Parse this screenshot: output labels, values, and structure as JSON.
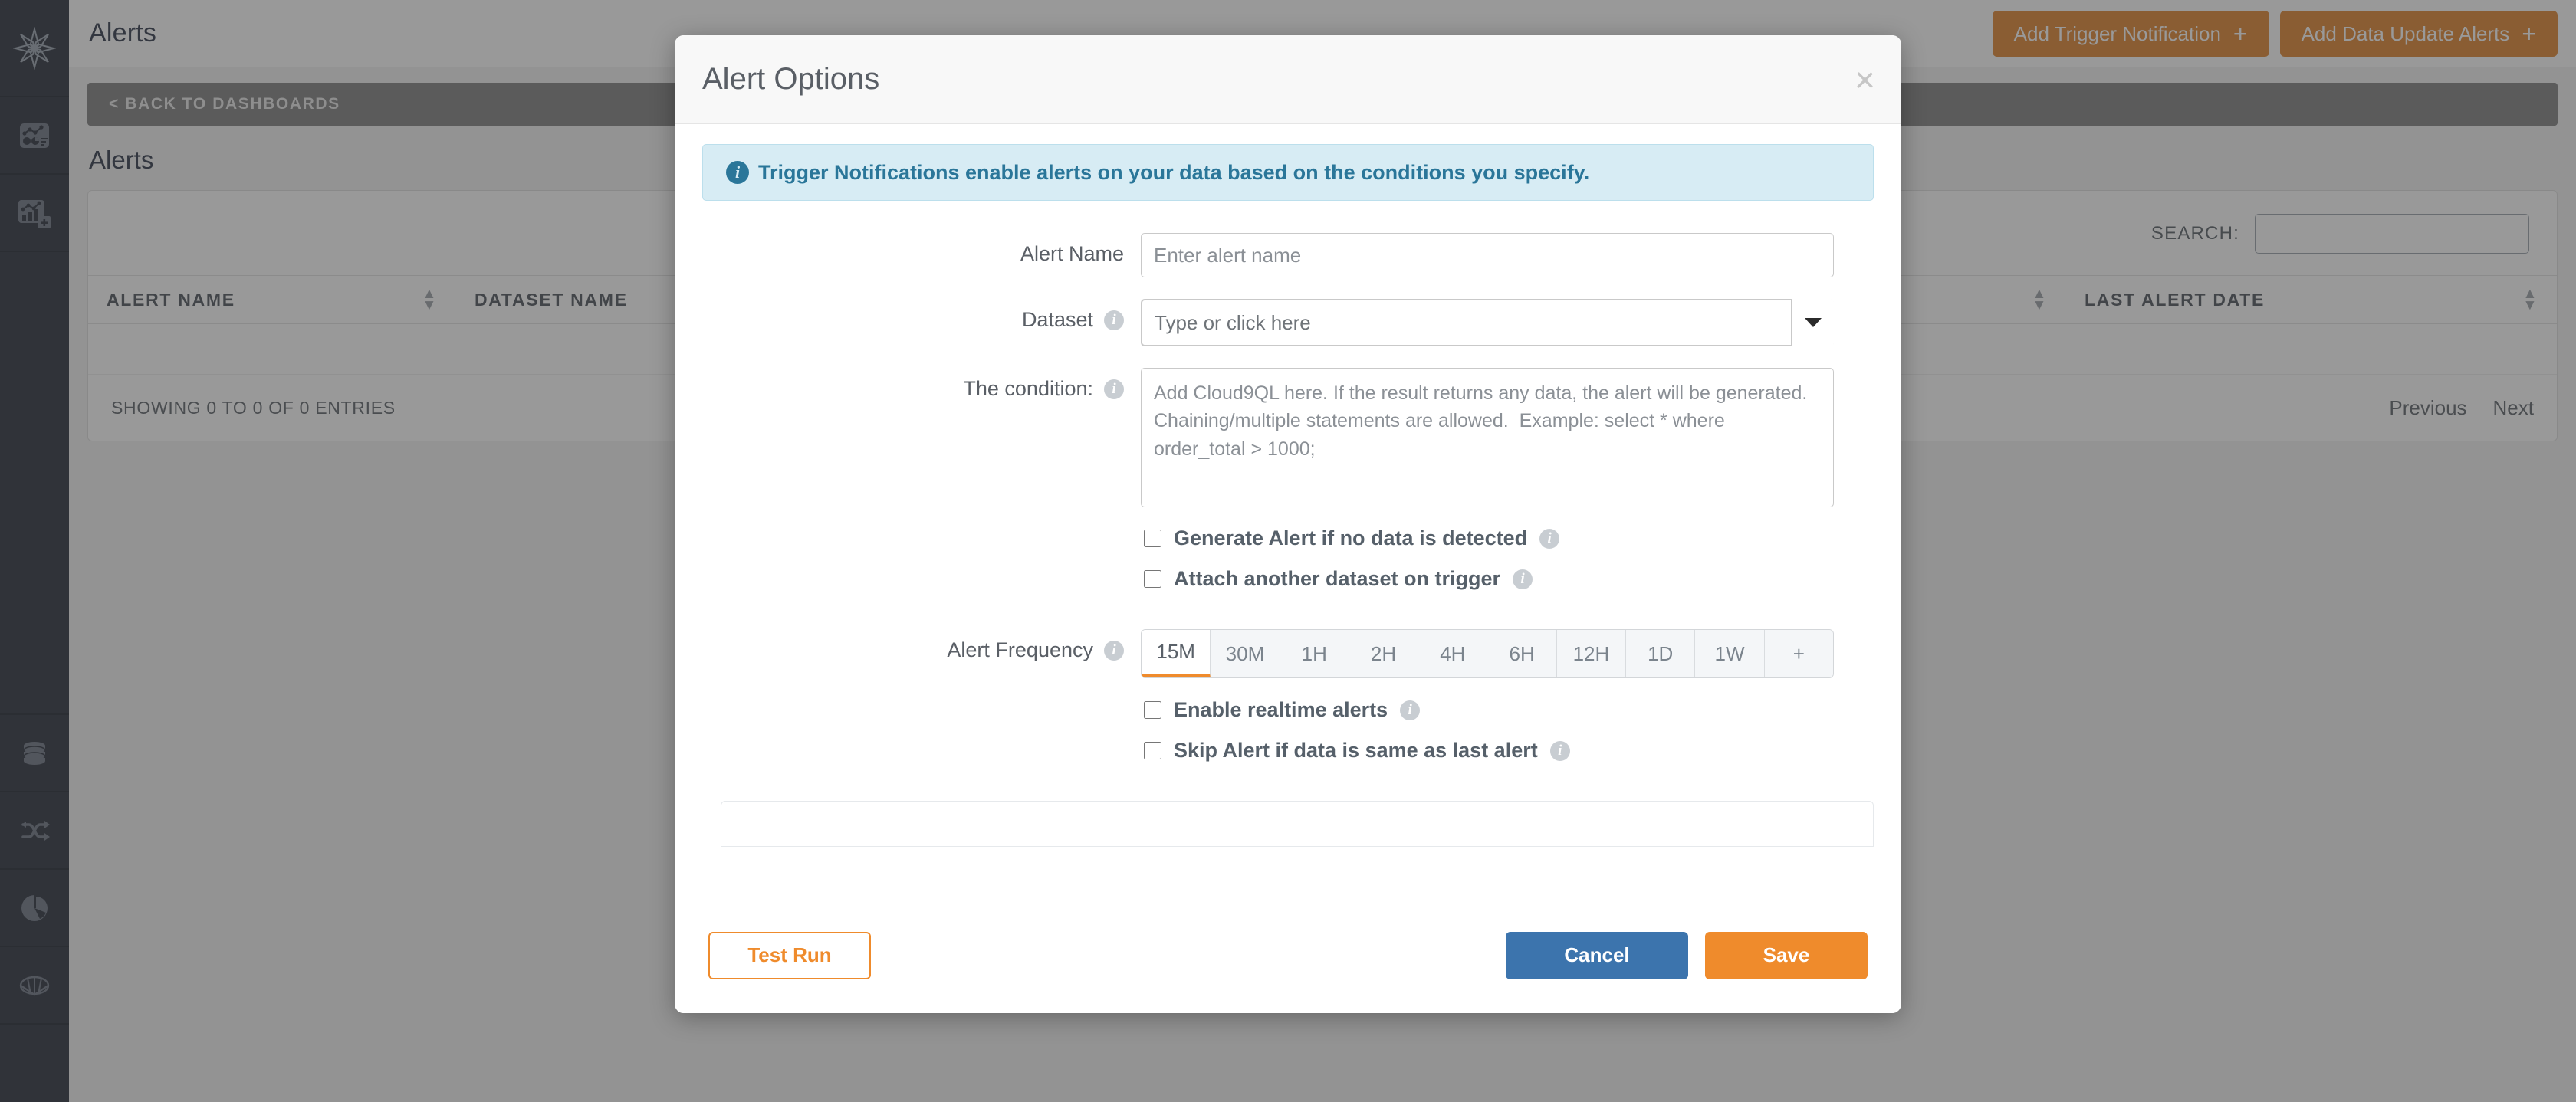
{
  "sidebar": {
    "logo_name": "app-logo",
    "items": [
      {
        "name": "dashboards-icon",
        "label": "Dashboards"
      },
      {
        "name": "add-chart-icon",
        "label": "Add Chart"
      },
      {
        "name": "database-icon",
        "label": "Datasets"
      },
      {
        "name": "shuffle-icon",
        "label": "Data Flows"
      },
      {
        "name": "pie-chart-icon",
        "label": "Reports"
      },
      {
        "name": "globe-icon",
        "label": "Global"
      }
    ]
  },
  "topbar": {
    "title": "Alerts",
    "add_trigger_notification": "Add Trigger Notification",
    "add_data_update_alerts": "Add Data Update Alerts",
    "plus": "+"
  },
  "backnav": {
    "label": "< BACK TO DASHBOARDS"
  },
  "page": {
    "title": "Alerts",
    "search_label": "SEARCH:",
    "search_value": "",
    "search_placeholder": "",
    "columns": [
      "ALERT NAME",
      "DATASET NAME",
      "",
      "LAST ALERT DATE"
    ],
    "showing": "SHOWING 0 TO 0 OF 0 ENTRIES",
    "previous": "Previous",
    "next": "Next"
  },
  "modal": {
    "title": "Alert Options",
    "close": "×",
    "info_icon": "i",
    "info_text": "Trigger Notifications enable alerts on your data based on the conditions you specify.",
    "fields": {
      "alert_name_label": "Alert Name",
      "alert_name_value": "",
      "alert_name_placeholder": "Enter alert name",
      "dataset_label": "Dataset",
      "dataset_value": "Type or click here",
      "condition_label": "The condition:",
      "condition_value": "",
      "condition_placeholder": "Add Cloud9QL here. If the result returns any data, the alert will be generated. Chaining/multiple statements are allowed.  Example: select * where order_total > 1000;",
      "alert_frequency_label": "Alert Frequency"
    },
    "checkboxes": [
      {
        "id": "no-data",
        "label": "Generate Alert if no data is detected",
        "checked": false
      },
      {
        "id": "attach-dataset",
        "label": "Attach another dataset on trigger",
        "checked": false
      }
    ],
    "checkboxes2": [
      {
        "id": "realtime",
        "label": "Enable realtime alerts",
        "checked": false
      },
      {
        "id": "skip-same",
        "label": "Skip Alert if data is same as last alert",
        "checked": false
      }
    ],
    "frequencies": [
      {
        "label": "15M",
        "active": true
      },
      {
        "label": "30M",
        "active": false
      },
      {
        "label": "1H",
        "active": false
      },
      {
        "label": "2H",
        "active": false
      },
      {
        "label": "4H",
        "active": false
      },
      {
        "label": "6H",
        "active": false
      },
      {
        "label": "12H",
        "active": false
      },
      {
        "label": "1D",
        "active": false
      },
      {
        "label": "1W",
        "active": false
      },
      {
        "label": "+",
        "active": false
      }
    ],
    "footer": {
      "test_run": "Test Run",
      "cancel": "Cancel",
      "save": "Save"
    }
  },
  "colors": {
    "accent_orange": "#ef8b2c",
    "brand_dark": "#242b38",
    "info_blue": "#2a7699",
    "cancel_blue": "#3c74ad"
  }
}
